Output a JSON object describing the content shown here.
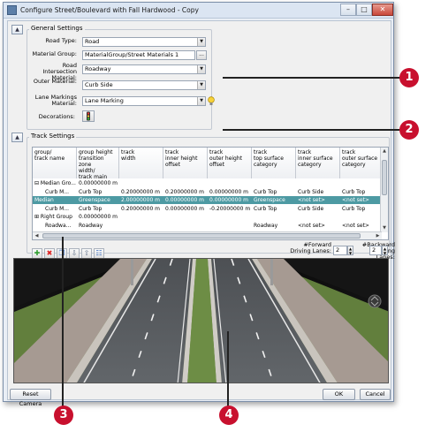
{
  "window": {
    "title": "Configure Street/Boulevard with Fall Hardwood - Copy",
    "controls": {
      "minimize": "–",
      "maximize": "□",
      "close": "✕"
    }
  },
  "general_settings": {
    "label": "General Settings",
    "fields": [
      {
        "label": "Road Type:",
        "value": "Road",
        "kind": "combo"
      },
      {
        "label": "Material Group:",
        "value": "MaterialGroup/Street Materials 1",
        "kind": "browse",
        "button": "..."
      },
      {
        "label": "Road Intersection Material:",
        "value": "Roadway",
        "kind": "combo"
      },
      {
        "label": "Outer Material:",
        "value": "Curb Side",
        "kind": "combo"
      },
      {
        "label": "Lane Markings Material:",
        "value": "Lane Marking",
        "kind": "combo"
      }
    ],
    "decorations_label": "Decorations:"
  },
  "track_settings": {
    "label": "Track Settings",
    "columns": [
      "group/\ntrack name",
      "group height\ntransition zone\nwidth/\ntrack main cate",
      "track\nwidth",
      "track\ninner height\noffset",
      "track\nouter height\noffset",
      "track\ntop surface\ncategory",
      "track\ninner surface\ncategory",
      "track\nouter surface\ncategory"
    ],
    "rows": [
      {
        "type": "group",
        "cells": [
          "⊟ Median Gro...",
          "0.00000000 m",
          "",
          "",
          "",
          "",
          "",
          ""
        ]
      },
      {
        "type": "track",
        "cells": [
          "Curb M...",
          "Curb Top",
          "0.20000000 m",
          "0.20000000 m",
          "0.00000000 m",
          "Curb Top",
          "Curb Side",
          "Curb Top"
        ]
      },
      {
        "type": "selected",
        "cells": [
          "Median",
          "Greenspace",
          "2.00000000 m",
          "0.00000000 m",
          "0.00000000 m",
          "Greenspace",
          "<not set>",
          "<not set>"
        ]
      },
      {
        "type": "track",
        "cells": [
          "Curb M...",
          "Curb Top",
          "0.20000000 m",
          "0.00000000 m",
          "-0.20000000 m",
          "Curb Top",
          "Curb Side",
          "Curb Top"
        ]
      },
      {
        "type": "group",
        "cells": [
          "⊞ Right Group",
          "0.00000000 m",
          "",
          "",
          "",
          "",
          "",
          ""
        ]
      },
      {
        "type": "track",
        "cells": [
          "Roadwa...",
          "Roadway",
          "",
          "",
          "",
          "Roadway",
          "<not set>",
          "<not set>"
        ]
      }
    ],
    "forward_lanes_label": "#Forward\nDriving Lanes:",
    "forward_lanes_value": "2",
    "backward_lanes_label": "#Backward\nDriving Lanes:",
    "backward_lanes_value": "2",
    "toolbar_icons": [
      "add-icon",
      "delete-icon",
      "copy-icon",
      "move-down-icon",
      "move-up-icon",
      "properties-icon"
    ],
    "toolbar_glyphs": [
      "✚",
      "✖",
      "❐",
      "⇩",
      "⇧",
      "☷"
    ]
  },
  "buttons": {
    "reset_camera": "Reset Camera",
    "ok": "OK",
    "cancel": "Cancel"
  },
  "callouts": [
    "1",
    "2",
    "3",
    "4"
  ],
  "colors": {
    "callout": "#c8102e",
    "selected_row": "#4d9aa3",
    "asphalt": "#5a5d60",
    "grass": "#6d8d45",
    "sidewalk": "#a69a92"
  }
}
